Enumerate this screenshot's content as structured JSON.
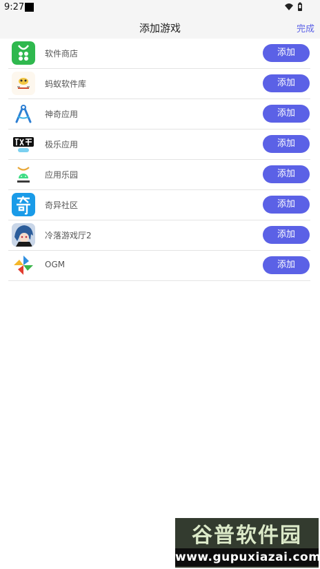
{
  "status_bar": {
    "time": "9:27"
  },
  "header": {
    "title": "添加游戏",
    "done_label": "完成"
  },
  "apps": [
    {
      "name": "软件商店",
      "icon": "software-store-icon",
      "button": "添加"
    },
    {
      "name": "蚂蚁软件库",
      "icon": "ant-library-icon",
      "button": "添加"
    },
    {
      "name": "神奇应用",
      "icon": "compass-app-icon",
      "button": "添加"
    },
    {
      "name": "极乐应用",
      "icon": "jile-app-icon",
      "button": "添加"
    },
    {
      "name": "应用乐园",
      "icon": "android-app-icon",
      "button": "添加"
    },
    {
      "name": "奇异社区",
      "icon": "qiyi-community-icon",
      "button": "添加"
    },
    {
      "name": "冷落游戏厅2",
      "icon": "anime-avatar-icon",
      "button": "添加"
    },
    {
      "name": "OGM",
      "icon": "pinwheel-icon",
      "button": "添加"
    }
  ],
  "watermark": {
    "top_text": "谷普软件园",
    "bottom_text": "www.gupuxiazai.com"
  },
  "colors": {
    "accent": "#5b61e6",
    "header_bg": "#f5f5f5",
    "divider": "#e3e3e3"
  }
}
